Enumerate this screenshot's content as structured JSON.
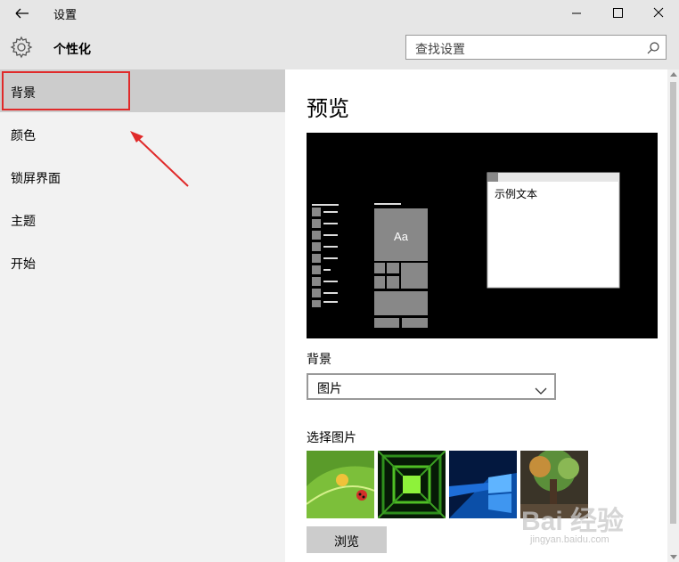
{
  "window": {
    "title": "设置"
  },
  "header": {
    "section_title": "个性化",
    "search_placeholder": "查找设置"
  },
  "sidebar": {
    "items": [
      {
        "label": "背景"
      },
      {
        "label": "颜色"
      },
      {
        "label": "锁屏界面"
      },
      {
        "label": "主题"
      },
      {
        "label": "开始"
      }
    ]
  },
  "main": {
    "preview_title": "预览",
    "preview_aa": "Aa",
    "preview_sample_text": "示例文本",
    "background_label": "背景",
    "background_value": "图片",
    "choose_picture_label": "选择图片",
    "browse_label": "浏览"
  },
  "watermark": {
    "text": "Bai 经验",
    "url": "jingyan.baidu.com"
  },
  "colors": {
    "accent_red": "#e02a2a",
    "sidebar_bg": "#f2f2f2",
    "selected_bg": "#cccccc"
  }
}
